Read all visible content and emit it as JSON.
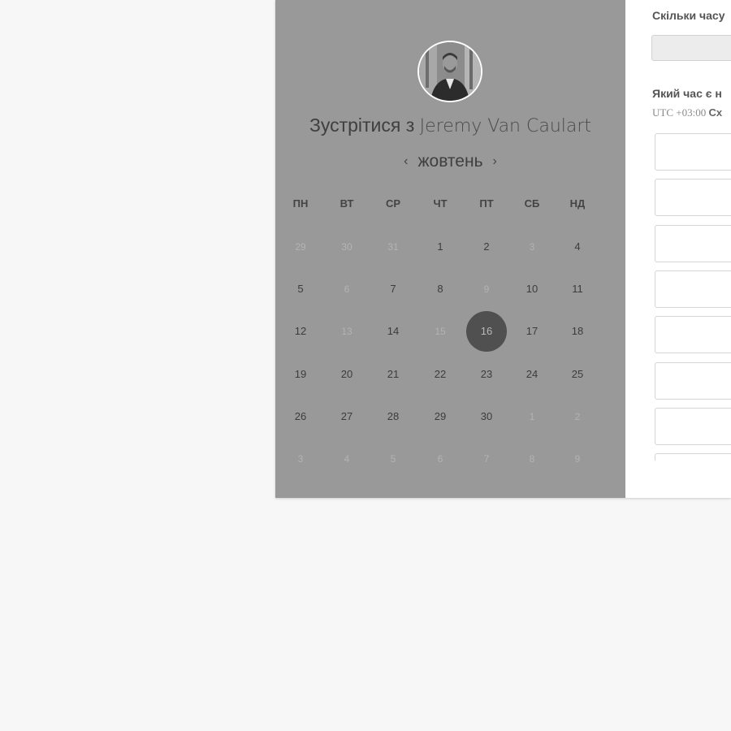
{
  "title": {
    "prefix": "Зустрітися з ",
    "name": "Jeremy Van Caulart"
  },
  "calendar": {
    "month": "жовтень",
    "prev_icon": "chevron-left-icon",
    "next_icon": "chevron-right-icon",
    "weekdays": [
      "ПН",
      "ВТ",
      "СР",
      "ЧТ",
      "ПТ",
      "СБ",
      "НД"
    ],
    "weeks": [
      [
        "29",
        "30",
        "31",
        "1",
        "2",
        "3",
        "4"
      ],
      [
        "5",
        "6",
        "7",
        "8",
        "9",
        "10",
        "11"
      ],
      [
        "12",
        "13",
        "14",
        "15",
        "16",
        "17",
        "18"
      ],
      [
        "19",
        "20",
        "21",
        "22",
        "23",
        "24",
        "25"
      ],
      [
        "26",
        "27",
        "28",
        "29",
        "30",
        "1",
        "2"
      ],
      [
        "3",
        "4",
        "5",
        "6",
        "7",
        "8",
        "9"
      ]
    ],
    "muted": [
      [
        true,
        true,
        true,
        false,
        false,
        true,
        false
      ],
      [
        false,
        true,
        false,
        false,
        true,
        false,
        false
      ],
      [
        false,
        true,
        false,
        true,
        false,
        false,
        false
      ],
      [
        false,
        false,
        false,
        false,
        false,
        false,
        false
      ],
      [
        false,
        false,
        false,
        false,
        false,
        true,
        true
      ],
      [
        true,
        true,
        true,
        true,
        true,
        true,
        true
      ]
    ],
    "selected": "16"
  },
  "booking": {
    "duration_question": "Скільки часу",
    "time_question": "Який час є н",
    "utc_offset": "UTC +03:00 ",
    "timezone_name": "Сх",
    "slot_count": 8
  },
  "colors": {
    "panel_bg": "#999999",
    "selected_day": "#505050",
    "page_bg": "#f7f7f7"
  }
}
